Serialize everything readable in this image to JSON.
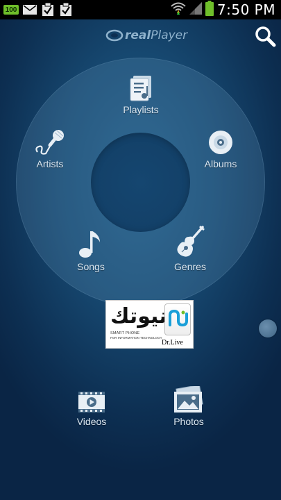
{
  "status_bar": {
    "battery_badge": "100",
    "time": "7:50 PM"
  },
  "header": {
    "logo_prefix": "real",
    "logo_suffix": "Player",
    "search_icon": "search-icon"
  },
  "menu": {
    "playlists": "Playlists",
    "artists": "Artists",
    "albums": "Albums",
    "songs": "Songs",
    "genres": "Genres"
  },
  "ad": {
    "arabic_text": "نيوتك",
    "line1": "SMART PHONE",
    "line2": "FOR INFORMATION TECHNOLOGY",
    "credit": "Dr.Live"
  },
  "bottom": {
    "videos": "Videos",
    "photos": "Photos"
  },
  "colors": {
    "background": "#16476f",
    "ring": "#5f8fb5",
    "label": "#dbe7f1",
    "battery_green": "#6fbf2a"
  }
}
